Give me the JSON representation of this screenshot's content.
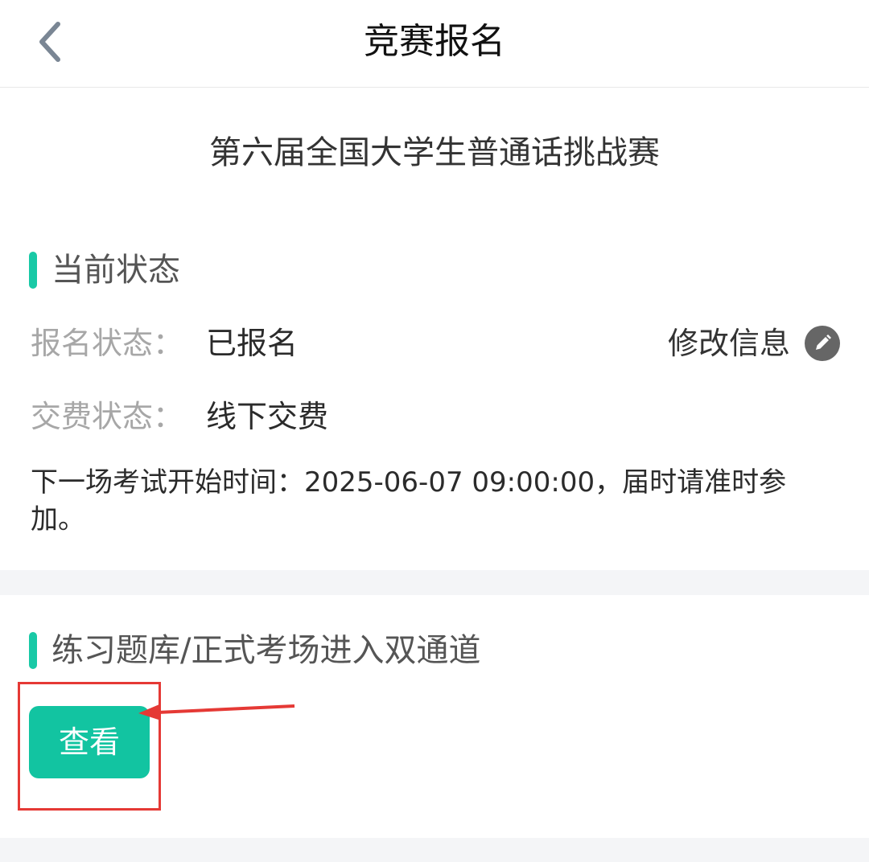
{
  "header": {
    "title": "竞赛报名",
    "back_icon": "chevron-left-icon"
  },
  "contest": {
    "name": "第六届全国大学生普通话挑战赛"
  },
  "status_section": {
    "heading": "当前状态",
    "registration": {
      "label": "报名状态：",
      "value": "已报名"
    },
    "fee": {
      "label": "交费状态：",
      "value": "线下交费"
    },
    "edit": {
      "label": "修改信息",
      "icon": "pencil-icon"
    },
    "next_exam_notice": "下一场考试开始时间：2025-06-07 09:00:00，届时请准时参加。"
  },
  "practice_section": {
    "heading": "练习题库/正式考场进入双通道",
    "view_button_label": "查看"
  },
  "colors": {
    "accent": "#12c4a1",
    "annotation": "#e53935"
  }
}
